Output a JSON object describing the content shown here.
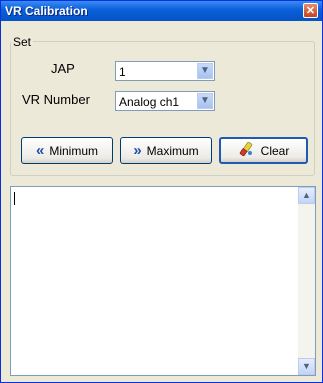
{
  "window": {
    "title": "VR Calibration",
    "close_glyph": "✕"
  },
  "set_group": {
    "label": "Set",
    "jap_label": "JAP",
    "jap_value": "1",
    "vr_number_label": "VR Number",
    "vr_number_value": "Analog ch1"
  },
  "buttons": {
    "minimum_label": "Minimum",
    "maximum_label": "Maximum",
    "clear_label": "Clear"
  },
  "output": {
    "text": ""
  },
  "icons": {
    "minimum": "double-chevron-left-icon",
    "maximum": "double-chevron-right-icon",
    "clear": "eraser-icon"
  }
}
